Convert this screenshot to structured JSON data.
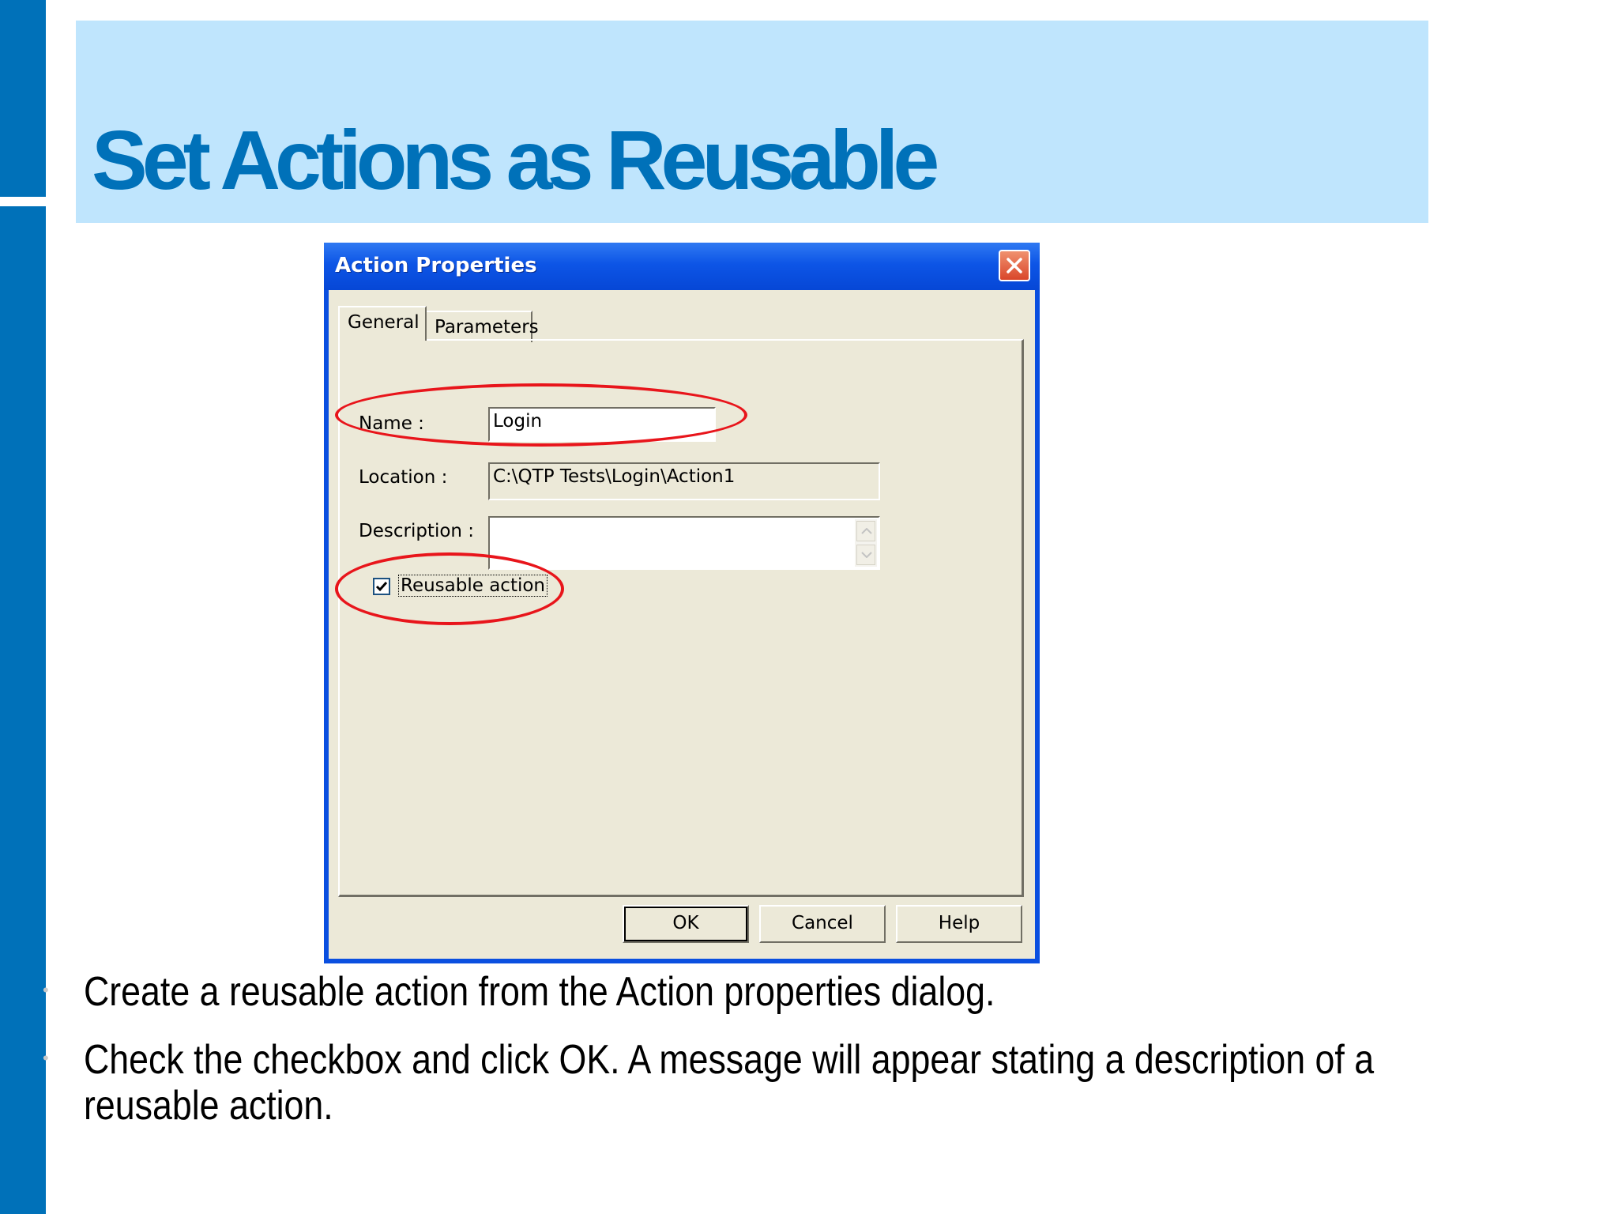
{
  "slide": {
    "title": "Set Actions as Reusable",
    "bullets": [
      "Create a reusable action from the Action properties dialog.",
      "Check the checkbox and click OK. A message will appear stating a description of a reusable action."
    ],
    "bullet_marker": "•",
    "accent_color": "#0071b9",
    "title_band_color": "#bfe5fd"
  },
  "dialog": {
    "title": "Action Properties",
    "tabs": [
      "General",
      "Parameters"
    ],
    "active_tab": "General",
    "fields": {
      "name_label": "Name :",
      "name_value": "Login",
      "location_label": "Location :",
      "location_value": "C:\\QTP Tests\\Login\\Action1",
      "description_label": "Description :",
      "description_value": ""
    },
    "reusable_checkbox": {
      "label": "Reusable action",
      "checked": true
    },
    "buttons": {
      "ok": "OK",
      "cancel": "Cancel",
      "help": "Help"
    },
    "highlight_color": "#e8151b"
  }
}
